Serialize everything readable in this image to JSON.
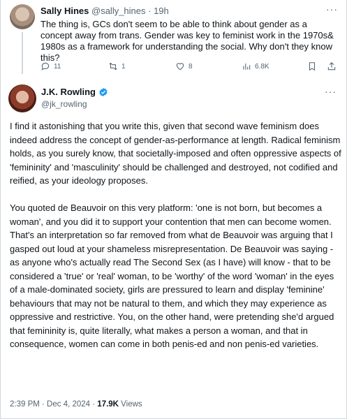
{
  "reply": {
    "name": "Sally Hines",
    "handle": "@sally_hines",
    "time": "· 19h",
    "text": "The thing is, GCs don't seem to be able to think about gender as a concept away from trans. Gender was key to feminist work in the 1970s& 1980s as a framework for understanding the social. Why don't they know this?",
    "stats": {
      "replies": "11",
      "reposts": "1",
      "likes": "8",
      "views": "6.8K"
    }
  },
  "tweet": {
    "name": "J.K. Rowling",
    "handle": "@jk_rowling",
    "paragraphs": [
      "I find it astonishing that you write this, given that second wave feminism does indeed address the concept of gender-as-performance at length. Radical feminism holds, as you surely know, that societally-imposed and often oppressive aspects of 'femininity' and 'masculinity' should be challenged and destroyed, not codified and reified, as your ideology proposes.",
      "You quoted de Beauvoir on this very platform: 'one is not born, but becomes a woman', and you did it to support your contention that men can become women. That's an interpretation so far removed from what de Beauvoir was arguing that I gasped out loud at your shameless misrepresentation. De Beauvoir was saying - as anyone who's actually read The Second Sex (as I have) will know - that to be considered a 'true' or 'real' woman, to be 'worthy' of the word 'woman' in the eyes of a male-dominated society, girls are pressured to learn and display 'feminine' behaviours that may not be natural to them, and which they may experience as oppressive and restrictive. You, on the other hand, were pretending she'd argued that femininity is, quite literally, what makes a person a woman, and that in consequence, women can come in both penis-ed and non penis-ed varieties."
    ],
    "timestamp": "2:39 PM · Dec 4, 2024 · ",
    "views_count": "17.9K",
    "views_label": " Views"
  },
  "icons": {
    "reply": "reply-icon",
    "repost": "repost-icon",
    "like": "heart-icon",
    "views": "views-icon",
    "bookmark": "bookmark-icon",
    "share": "share-icon",
    "verified": "verified-badge-icon",
    "more": "more-icon"
  },
  "colors": {
    "text": "#0f1419",
    "secondary": "#536471",
    "verified": "#1d9bf0"
  }
}
